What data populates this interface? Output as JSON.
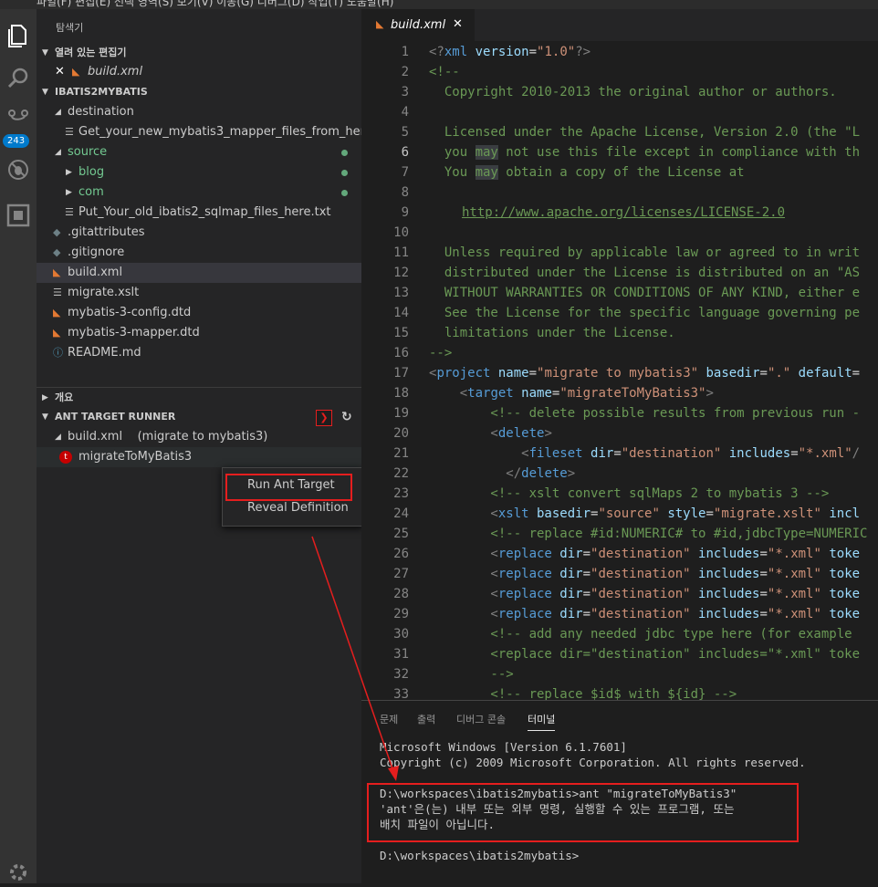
{
  "top_menu": "파일(F)   편집(E)   선택 영역(S)   보기(V)   이동(G)   디버그(D)   작업(T)   도움말(H)",
  "sidebar": {
    "title": "탐색기",
    "open_editors": {
      "header": "열려 있는 편집기",
      "items": [
        {
          "label": "build.xml"
        }
      ]
    },
    "project": {
      "header": "IBATIS2MYBATIS",
      "tree": [
        {
          "label": "destination"
        },
        {
          "label": "Get_your_new_mybatis3_mapper_files_from_here.txt"
        },
        {
          "label": "source"
        },
        {
          "label": "blog"
        },
        {
          "label": "com"
        },
        {
          "label": "Put_Your_old_ibatis2_sqlmap_files_here.txt"
        },
        {
          "label": ".gitattributes"
        },
        {
          "label": ".gitignore"
        },
        {
          "label": "build.xml"
        },
        {
          "label": "migrate.xslt"
        },
        {
          "label": "mybatis-3-config.dtd"
        },
        {
          "label": "mybatis-3-mapper.dtd"
        },
        {
          "label": "README.md"
        }
      ]
    },
    "outline": {
      "header": "개요"
    },
    "ant": {
      "header": "ANT TARGET RUNNER",
      "build_item": "build.xml    (migrate to mybatis3)",
      "target": "migrateToMyBatis3"
    }
  },
  "activity": {
    "badge": "243"
  },
  "context_menu": {
    "items": [
      "Run Ant Target",
      "Reveal Definition"
    ]
  },
  "editor": {
    "tab": "build.xml",
    "current_line": 6,
    "lines": [
      {
        "n": "1"
      },
      {
        "n": "2"
      },
      {
        "n": "3"
      },
      {
        "n": "4"
      },
      {
        "n": "5"
      },
      {
        "n": "6"
      },
      {
        "n": "7"
      },
      {
        "n": "8"
      },
      {
        "n": "9"
      },
      {
        "n": "10"
      },
      {
        "n": "11"
      },
      {
        "n": "12"
      },
      {
        "n": "13"
      },
      {
        "n": "14"
      },
      {
        "n": "15"
      },
      {
        "n": "16"
      },
      {
        "n": "17"
      },
      {
        "n": "18"
      },
      {
        "n": "19"
      },
      {
        "n": "20"
      },
      {
        "n": "21"
      },
      {
        "n": "22"
      },
      {
        "n": "23"
      },
      {
        "n": "24"
      },
      {
        "n": "25"
      },
      {
        "n": "26"
      },
      {
        "n": "27"
      },
      {
        "n": "28"
      },
      {
        "n": "29"
      },
      {
        "n": "30"
      },
      {
        "n": "31"
      },
      {
        "n": "32"
      },
      {
        "n": "33"
      }
    ],
    "code": {
      "l1": [
        "<?",
        "xml",
        " version",
        "=",
        "\"1.0\"",
        "?>"
      ],
      "l2": "<!--",
      "l3": "  Copyright 2010-2013 the original author or authors.",
      "l5": "  Licensed under the Apache License, Version 2.0 (the \"L",
      "l6a": "  you ",
      "l6b": "may",
      "l6c": " not use this file except in compliance with th",
      "l7a": "  You ",
      "l7b": "may",
      "l7c": " obtain a copy of the License at",
      "l9": "http://www.apache.org/licenses/LICENSE-2.0",
      "l11": "  Unless required by applicable law or agreed to in writ",
      "l12": "  distributed under the License is distributed on an \"AS",
      "l13": "  WITHOUT WARRANTIES OR CONDITIONS OF ANY KIND, either e",
      "l14": "  See the License for the specific language governing pe",
      "l15": "  limitations under the License.",
      "l16": "-->",
      "l17": [
        "<",
        "project",
        " name",
        "=",
        "\"migrate to mybatis3\"",
        " basedir",
        "=",
        "\".\"",
        " default",
        "="
      ],
      "l18": [
        "    <",
        "target",
        " name",
        "=",
        "\"migrateToMyBatis3\"",
        ">"
      ],
      "l19": "        <!-- delete possible results from previous run -",
      "l20": [
        "        <",
        "delete",
        ">"
      ],
      "l21": [
        "            <",
        "fileset",
        " dir",
        "=",
        "\"destination\"",
        " includes",
        "=",
        "\"*.xml\"",
        "/"
      ],
      "l22": [
        "          </",
        "delete",
        ">"
      ],
      "l23": "        <!-- xslt convert sqlMaps 2 to mybatis 3 -->",
      "l24": [
        "        <",
        "xslt",
        " basedir",
        "=",
        "\"source\"",
        " style",
        "=",
        "\"migrate.xslt\"",
        " incl"
      ],
      "l25": "        <!-- replace #id:NUMERIC# to #id,jdbcType=NUMERIC",
      "l26": [
        "        <",
        "replace",
        " dir",
        "=",
        "\"destination\"",
        " includes",
        "=",
        "\"*.xml\"",
        " toke"
      ],
      "l27": [
        "        <",
        "replace",
        " dir",
        "=",
        "\"destination\"",
        " includes",
        "=",
        "\"*.xml\"",
        " toke"
      ],
      "l28": [
        "        <",
        "replace",
        " dir",
        "=",
        "\"destination\"",
        " includes",
        "=",
        "\"*.xml\"",
        " toke"
      ],
      "l29": [
        "        <",
        "replace",
        " dir",
        "=",
        "\"destination\"",
        " includes",
        "=",
        "\"*.xml\"",
        " toke"
      ],
      "l30": "        <!-- add any needed jdbc type here (for example",
      "l31": "        <replace dir=\"destination\" includes=\"*.xml\" toke",
      "l32": "        -->",
      "l33": "        <!-- replace $id$ with ${id} -->"
    }
  },
  "panel": {
    "tabs": [
      "문제",
      "출력",
      "디버그 콘솔",
      "터미널"
    ],
    "active_tab": "터미널",
    "terminal": [
      "Microsoft Windows [Version 6.1.7601]",
      "Copyright (c) 2009 Microsoft Corporation. All rights reserved.",
      "D:\\workspaces\\ibatis2mybatis>ant \"migrateToMyBatis3\"",
      "'ant'은(는) 내부 또는 외부 명령, 실행할 수 있는 프로그램, 또는",
      "배치 파일이 아닙니다.",
      "D:\\workspaces\\ibatis2mybatis>"
    ]
  },
  "colors": {
    "annotation_red": "#e51e1e",
    "accent_blue": "#007acc",
    "git_green": "#73c991",
    "xml_orange": "#e37933"
  }
}
